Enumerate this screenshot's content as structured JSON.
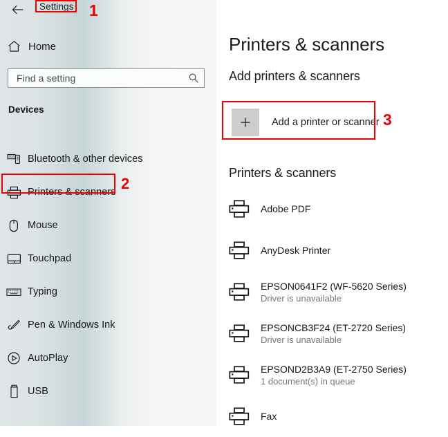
{
  "window": {
    "app_title": "Settings",
    "back_icon": "back-arrow-icon"
  },
  "sidebar": {
    "home_label": "Home",
    "home_icon": "home-icon",
    "search": {
      "value": "",
      "placeholder": "Find a setting",
      "icon": "search-icon"
    },
    "section_header": "Devices",
    "items": [
      {
        "label": "Bluetooth & other devices",
        "icon": "bluetooth-devices-icon",
        "selected": false
      },
      {
        "label": "Printers & scanners",
        "icon": "printer-icon",
        "selected": true
      },
      {
        "label": "Mouse",
        "icon": "mouse-icon",
        "selected": false
      },
      {
        "label": "Touchpad",
        "icon": "touchpad-icon",
        "selected": false
      },
      {
        "label": "Typing",
        "icon": "keyboard-icon",
        "selected": false
      },
      {
        "label": "Pen & Windows Ink",
        "icon": "pen-icon",
        "selected": false
      },
      {
        "label": "AutoPlay",
        "icon": "autoplay-icon",
        "selected": false
      },
      {
        "label": "USB",
        "icon": "usb-icon",
        "selected": false
      }
    ]
  },
  "main": {
    "page_title": "Printers & scanners",
    "add_section_title": "Add printers & scanners",
    "add_button_label": "Add a printer or scanner",
    "add_button_icon": "plus-icon",
    "list_section_title": "Printers & scanners",
    "printers": [
      {
        "name": "Adobe PDF",
        "status": "",
        "icon": "printer-icon"
      },
      {
        "name": "AnyDesk Printer",
        "status": "",
        "icon": "printer-icon"
      },
      {
        "name": "EPSON0641F2 (WF-5620 Series)",
        "status": "Driver is unavailable",
        "icon": "printer-icon"
      },
      {
        "name": "EPSONCB3F24 (ET-2720 Series)",
        "status": "Driver is unavailable",
        "icon": "printer-icon"
      },
      {
        "name": "EPSOND2B3A9 (ET-2750 Series)",
        "status": "1 document(s) in queue",
        "icon": "printer-icon"
      },
      {
        "name": "Fax",
        "status": "",
        "icon": "printer-icon"
      }
    ]
  },
  "annotations": {
    "color": "#ee0000",
    "steps": [
      {
        "number": "1",
        "target": "settings-title"
      },
      {
        "number": "2",
        "target": "sidebar-item-printers-scanners"
      },
      {
        "number": "3",
        "target": "add-printer-button"
      }
    ]
  }
}
